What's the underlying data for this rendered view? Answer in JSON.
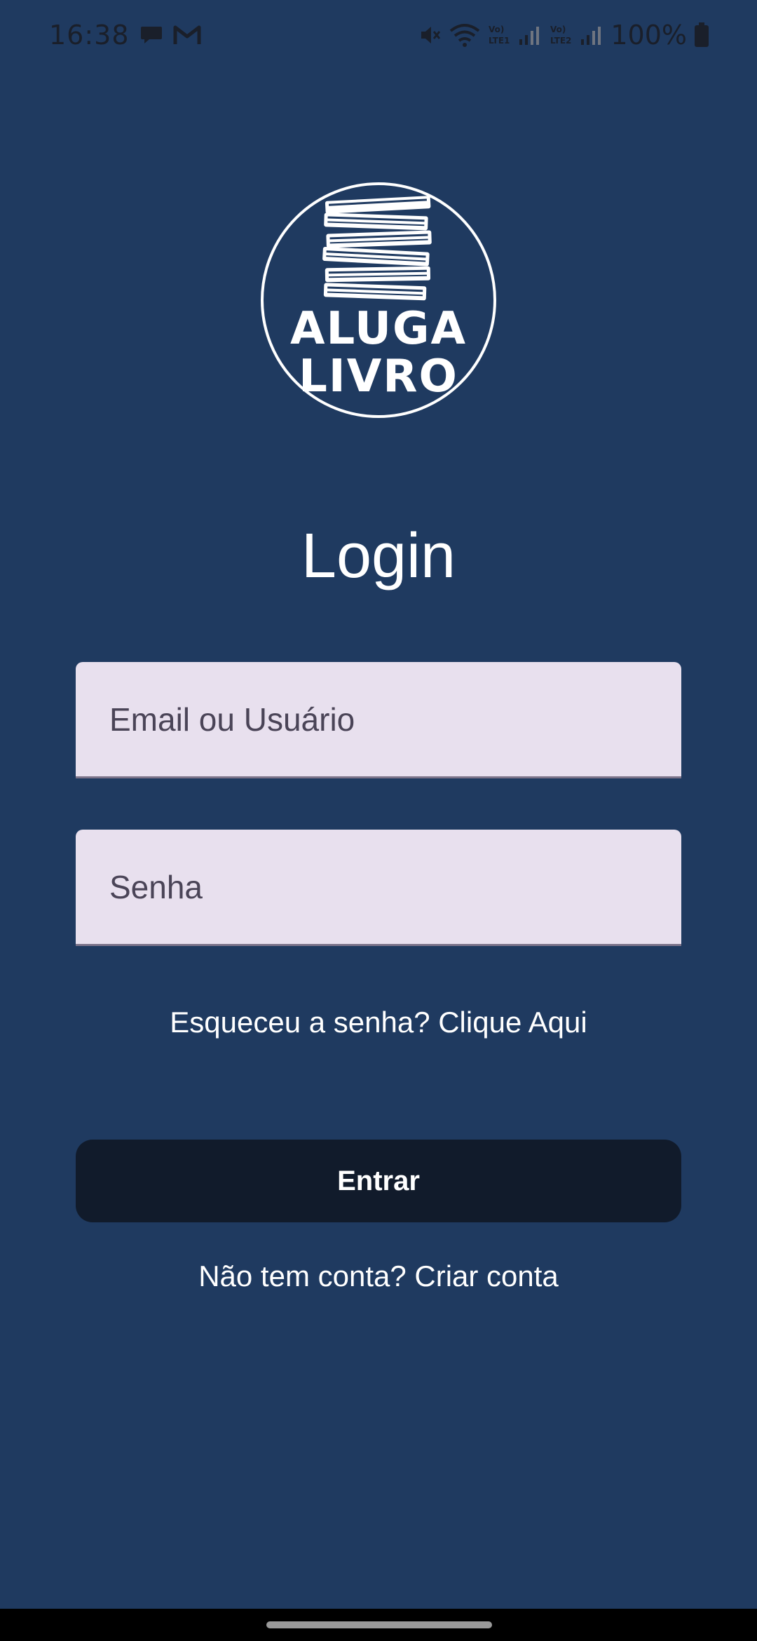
{
  "status_bar": {
    "time": "16:38",
    "battery": "100%",
    "icons": [
      "chat-bubble-icon",
      "gmail-icon",
      "mute-icon",
      "wifi-icon",
      "signal-lte1-icon",
      "signal-lte2-icon",
      "battery-icon"
    ]
  },
  "logo": {
    "line1": "ALUGA",
    "line2": "LIVRO"
  },
  "page": {
    "title": "Login"
  },
  "form": {
    "email_placeholder": "Email ou Usuário",
    "email_value": "",
    "password_placeholder": "Senha",
    "password_value": "",
    "forgot_link": "Esqueceu a senha? Clique Aqui",
    "submit_label": "Entrar",
    "signup_link": "Não tem conta? Criar conta"
  },
  "colors": {
    "background": "#1f3a60",
    "input_background": "#e8e0ee",
    "button_background": "#111b2b",
    "text": "#ffffff"
  }
}
